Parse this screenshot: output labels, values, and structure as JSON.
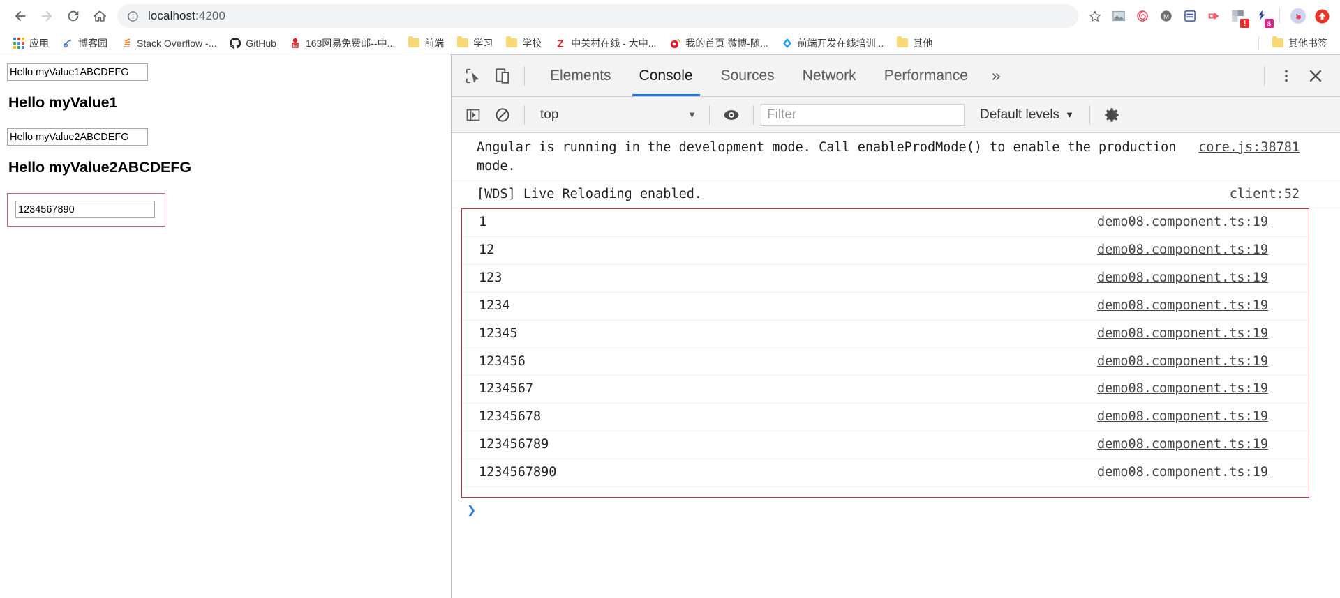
{
  "browser": {
    "nav": {
      "back_label": "Back",
      "forward_label": "Forward",
      "reload_label": "Reload",
      "home_label": "Home"
    },
    "omnibox": {
      "url_host": "localhost",
      "url_port": ":4200",
      "info_icon": "info-circle-icon"
    },
    "toolbar_icons": [
      {
        "name": "bookmark-star-icon",
        "glyph": "☆"
      },
      {
        "name": "screenshot-extension-icon"
      },
      {
        "name": "openai-extension-icon"
      },
      {
        "name": "metamask-extension-icon",
        "glyph": "M"
      },
      {
        "name": "notes-extension-icon"
      },
      {
        "name": "translate-extension-icon"
      },
      {
        "name": "warning-extension-icon",
        "badge": "!"
      },
      {
        "name": "script-extension-icon",
        "badge": "$"
      },
      {
        "name": "profile-avatar-icon"
      },
      {
        "name": "update-browser-icon"
      }
    ]
  },
  "bookmarks": {
    "apps_label": "应用",
    "items": [
      {
        "label": "博客园",
        "icon": "cnblogs-icon"
      },
      {
        "label": "Stack Overflow -...",
        "icon": "stackoverflow-icon"
      },
      {
        "label": "GitHub",
        "icon": "github-icon"
      },
      {
        "label": "163网易免费邮--中...",
        "icon": "netease-mail-icon"
      },
      {
        "label": "前端",
        "icon": "folder-icon"
      },
      {
        "label": "学习",
        "icon": "folder-icon"
      },
      {
        "label": "学校",
        "icon": "folder-icon"
      },
      {
        "label": "中关村在线 - 大中...",
        "icon": "zol-icon"
      },
      {
        "label": "我的首页 微博-随...",
        "icon": "weibo-icon"
      },
      {
        "label": "前端开发在线培训...",
        "icon": "blue-diamond-icon"
      },
      {
        "label": "其他",
        "icon": "folder-icon"
      }
    ],
    "other_bookmarks": "其他书签"
  },
  "page": {
    "input1_value": "Hello myValue1ABCDEFG",
    "heading1": "Hello myValue1",
    "input2_value": "Hello myValue2ABCDEFG",
    "heading2": "Hello myValue2ABCDEFG",
    "input3_value": "1234567890",
    "input_placeholder": ""
  },
  "devtools": {
    "inspect_icon": "inspect-element-icon",
    "device_icon": "toggle-device-toolbar-icon",
    "tabs": [
      {
        "label": "Elements",
        "active": false
      },
      {
        "label": "Console",
        "active": true
      },
      {
        "label": "Sources",
        "active": false
      },
      {
        "label": "Network",
        "active": false
      },
      {
        "label": "Performance",
        "active": false
      }
    ],
    "more_tabs_glyph": "»",
    "kebab_icon": "more-options-icon",
    "close_icon": "close-devtools-icon",
    "filterbar": {
      "sidebar_icon": "console-sidebar-icon",
      "clear_icon": "clear-console-icon",
      "context": "top",
      "context_caret": "▼",
      "eye_icon": "live-expression-icon",
      "filter_placeholder": "Filter",
      "filter_value": "",
      "levels_label": "Default levels",
      "levels_caret": "▼",
      "settings_icon": "devtools-settings-icon"
    },
    "console": {
      "messages": [
        {
          "text": "Angular is running in the development mode. Call enableProdMode() to enable the production mode.",
          "source": "core.js:38781"
        },
        {
          "text": "[WDS] Live Reloading enabled.",
          "source": "client:52"
        }
      ],
      "selected_messages": [
        {
          "text": "1",
          "source": "demo08.component.ts:19"
        },
        {
          "text": "12",
          "source": "demo08.component.ts:19"
        },
        {
          "text": "123",
          "source": "demo08.component.ts:19"
        },
        {
          "text": "1234",
          "source": "demo08.component.ts:19"
        },
        {
          "text": "12345",
          "source": "demo08.component.ts:19"
        },
        {
          "text": "123456",
          "source": "demo08.component.ts:19"
        },
        {
          "text": "1234567",
          "source": "demo08.component.ts:19"
        },
        {
          "text": "12345678",
          "source": "demo08.component.ts:19"
        },
        {
          "text": "123456789",
          "source": "demo08.component.ts:19"
        },
        {
          "text": "1234567890",
          "source": "demo08.component.ts:19"
        }
      ],
      "prompt_glyph": "❯"
    }
  },
  "colors": {
    "accent": "#1a73e8",
    "selection_border": "#bb3344",
    "form_border": "#cc6677",
    "omnibox_bg": "#f1f3f4",
    "devtools_bg": "#f3f3f3"
  }
}
